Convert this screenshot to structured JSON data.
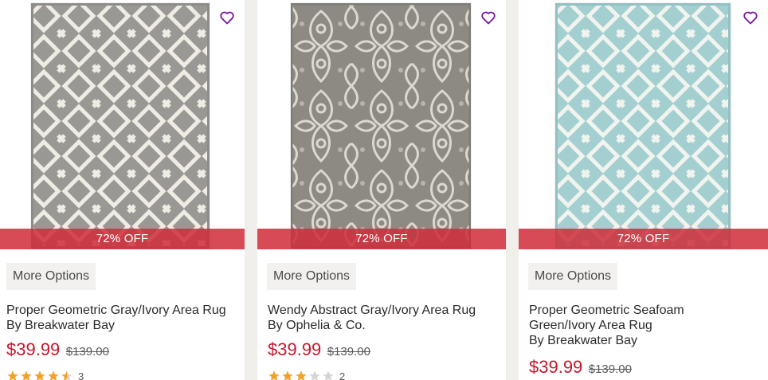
{
  "products": [
    {
      "title_line1": "Proper Geometric Gray/Ivory Area Rug",
      "title_line2": "By Breakwater Bay",
      "title_line3": "",
      "discount": "72% OFF",
      "more_options": "More Options",
      "price": "$39.99",
      "old_price": "$139.00",
      "rating": 4.5,
      "review_count": "3",
      "rug_colors": {
        "base": "#9a9895",
        "pattern": "#efece4"
      },
      "icon": "heart-icon"
    },
    {
      "title_line1": "Wendy Abstract Gray/Ivory Area Rug",
      "title_line2": "By Ophelia & Co.",
      "title_line3": "",
      "discount": "72% OFF",
      "more_options": "More Options",
      "price": "$39.99",
      "old_price": "$139.00",
      "rating": 3,
      "review_count": "2",
      "rug_colors": {
        "base": "#8d8a84",
        "pattern": "#e9e6dc"
      },
      "icon": "heart-icon"
    },
    {
      "title_line1": "Proper Geometric Seafoam",
      "title_line2": "Green/Ivory Area Rug",
      "title_line3": "By Breakwater Bay",
      "discount": "72% OFF",
      "more_options": "More Options",
      "price": "$39.99",
      "old_price": "$139.00",
      "rating": null,
      "review_count": "",
      "rug_colors": {
        "base": "#a4cfd1",
        "pattern": "#f1f4ee"
      },
      "icon": "heart-icon"
    }
  ],
  "colors": {
    "accent_heart": "#7b189f",
    "price_red": "#c4182e",
    "star_filled": "#f0a229",
    "star_empty": "#d5d5d5"
  }
}
